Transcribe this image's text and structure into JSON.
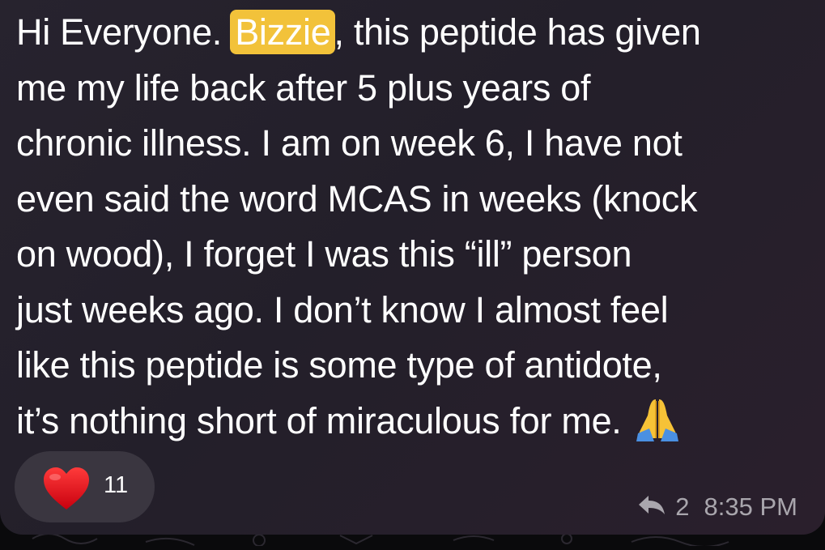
{
  "message": {
    "lines": [
      {
        "before": "Hi Everyone. ",
        "mention": "Bizzie",
        "after": ", this peptide has given"
      },
      "me my life back after 5 plus years of",
      "chronic illness. I am on week 6, I have not",
      "even said the word MCAS in weeks (knock",
      "on wood), I forget I was this “ill” person",
      "just weeks ago. I don’t know I almost feel",
      "like this peptide is some type of antidote,",
      "it’s nothing short of miraculous for me."
    ],
    "emoji": "folded-hands"
  },
  "reaction": {
    "icon": "heart-icon",
    "count": "11"
  },
  "meta": {
    "reply_icon": "reply-arrow-icon",
    "reply_count": "2",
    "time": "8:35 PM"
  },
  "colors": {
    "bubble_bg": "#26222d",
    "mention_bg": "#f2c23a",
    "heart": "#e3141f",
    "meta_text": "#a9a6ad",
    "reaction_pill": "#3a3640"
  }
}
